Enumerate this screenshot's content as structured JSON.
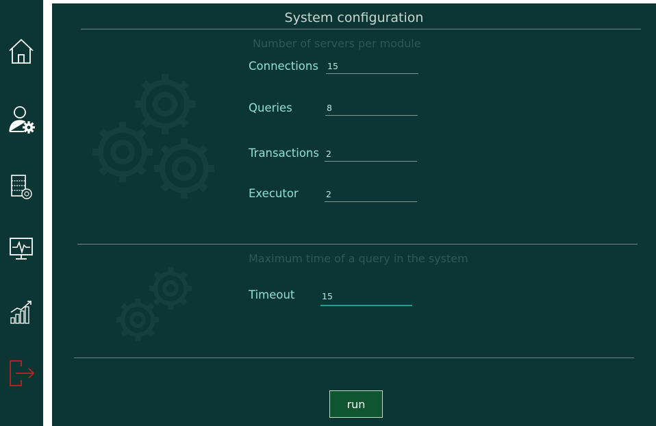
{
  "page": {
    "title": "System configuration"
  },
  "sidebar": {
    "items": [
      {
        "icon": "home-icon"
      },
      {
        "icon": "user-settings-icon"
      },
      {
        "icon": "server-settings-icon"
      },
      {
        "icon": "monitor-icon"
      },
      {
        "icon": "chart-icon"
      },
      {
        "icon": "logout-icon",
        "color": "#c0221f"
      }
    ]
  },
  "servers_section": {
    "heading": "Number of servers per module",
    "fields": [
      {
        "label": "Connections",
        "value": "15"
      },
      {
        "label": "Queries",
        "value": "8"
      },
      {
        "label": "Transactions",
        "value": "2"
      },
      {
        "label": "Executor",
        "value": "2"
      }
    ]
  },
  "timeout_section": {
    "heading": "Maximum time of a query in the system",
    "field": {
      "label": "Timeout",
      "value": "15"
    }
  },
  "actions": {
    "run_label": "run"
  },
  "colors": {
    "background": "#0c3634",
    "accent": "#1fa095",
    "label": "#8ee0d2",
    "button": "#0e5530"
  }
}
